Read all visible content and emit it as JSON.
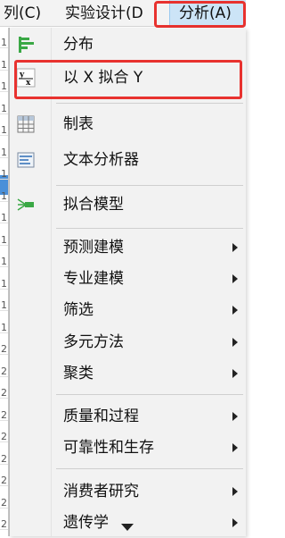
{
  "menubar": {
    "column": "列(C)",
    "experiment": "实验设计(D",
    "analyze": "分析(A)"
  },
  "left_grid": {
    "row_marks": [
      "1",
      "1",
      "1",
      "1",
      "1",
      "1",
      "1",
      "1",
      "1",
      "1",
      "1",
      "1",
      "1",
      "1",
      "2",
      "2",
      "2",
      "2",
      "2",
      "2",
      "2",
      "2",
      "2"
    ]
  },
  "menu": {
    "items": [
      {
        "label": "分布",
        "icon": "distribution-icon",
        "submenu": false
      },
      {
        "label": "以 X 拟合 Y",
        "icon": "fit-y-by-x-icon",
        "submenu": false
      },
      {
        "label": "制表",
        "icon": "tabulate-icon",
        "submenu": false
      },
      {
        "label": "文本分析器",
        "icon": "text-explorer-icon",
        "submenu": false
      },
      {
        "label": "拟合模型",
        "icon": "fit-model-icon",
        "submenu": false
      },
      {
        "label": "预测建模",
        "submenu": true
      },
      {
        "label": "专业建模",
        "submenu": true
      },
      {
        "label": "筛选",
        "submenu": true
      },
      {
        "label": "多元方法",
        "submenu": true
      },
      {
        "label": "聚类",
        "submenu": true
      },
      {
        "label": "质量和过程",
        "submenu": true
      },
      {
        "label": "可靠性和生存",
        "submenu": true
      },
      {
        "label": "消费者研究",
        "submenu": true
      },
      {
        "label": "遗传学",
        "submenu": true
      }
    ]
  },
  "colors": {
    "highlight_box": "#e8322f",
    "menu_bg": "#f2f2f2",
    "active_menu_bg": "#cce4f7",
    "icon_green": "#3aa845",
    "icon_blue": "#2f6db5"
  }
}
